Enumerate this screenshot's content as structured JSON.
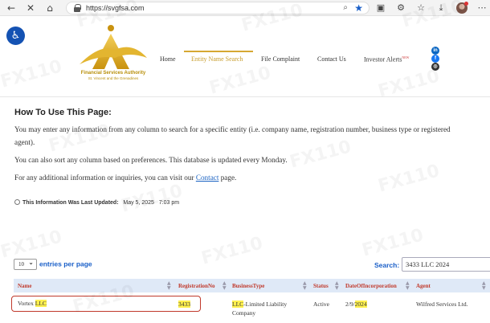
{
  "browser": {
    "url": "https://svgfsa.com"
  },
  "header": {
    "logo_line1": "Financial Services Authority",
    "logo_line2": "St. Vincent and the Grenadines",
    "menu": [
      {
        "label": "Home"
      },
      {
        "label": "Entity Name Search"
      },
      {
        "label": "File Complaint"
      },
      {
        "label": "Contact Us"
      },
      {
        "label": "Investor Alerts",
        "badge": "NEW"
      }
    ]
  },
  "content": {
    "title": "How To Use This Page:",
    "para1": "You may enter any information from any column to search for a specific entity (i.e. company name, registration number, business type or registered",
    "para1b": "agent).",
    "para2": "You can also sort any column based on preferences. This database is updated every Monday.",
    "para3_pre": "For any additional information or inquiries, you can visit our ",
    "para3_link": "Contact",
    "para3_post": " page.",
    "updated_label": "This Information Was Last Updated:",
    "updated_date": "May 5, 2025",
    "updated_time": "7:03 pm"
  },
  "table": {
    "entries_value": "10",
    "entries_label": "entries per page",
    "search_label": "Search:",
    "search_value": "3433 LLC 2024",
    "columns": [
      "Name",
      "RegistrationNo",
      "BusinessType",
      "Status",
      "DateOfIncorporation",
      "Agent"
    ],
    "row": {
      "name_pre": "Vortex ",
      "name_hl": "LLC",
      "reg_no": "3433",
      "btype_hl": "LLC",
      "btype_line1": "-Limited Liability",
      "btype_line2": "Company",
      "status": "Active",
      "date_pre": "2/9/",
      "date_hl": "2024",
      "agent": "Wilfred Services Ltd."
    }
  },
  "colors": {
    "accent_gold": "#d6a832",
    "link_blue": "#1a5fc8",
    "header_red": "#c0392b",
    "highlight_yellow": "#fff14f"
  }
}
